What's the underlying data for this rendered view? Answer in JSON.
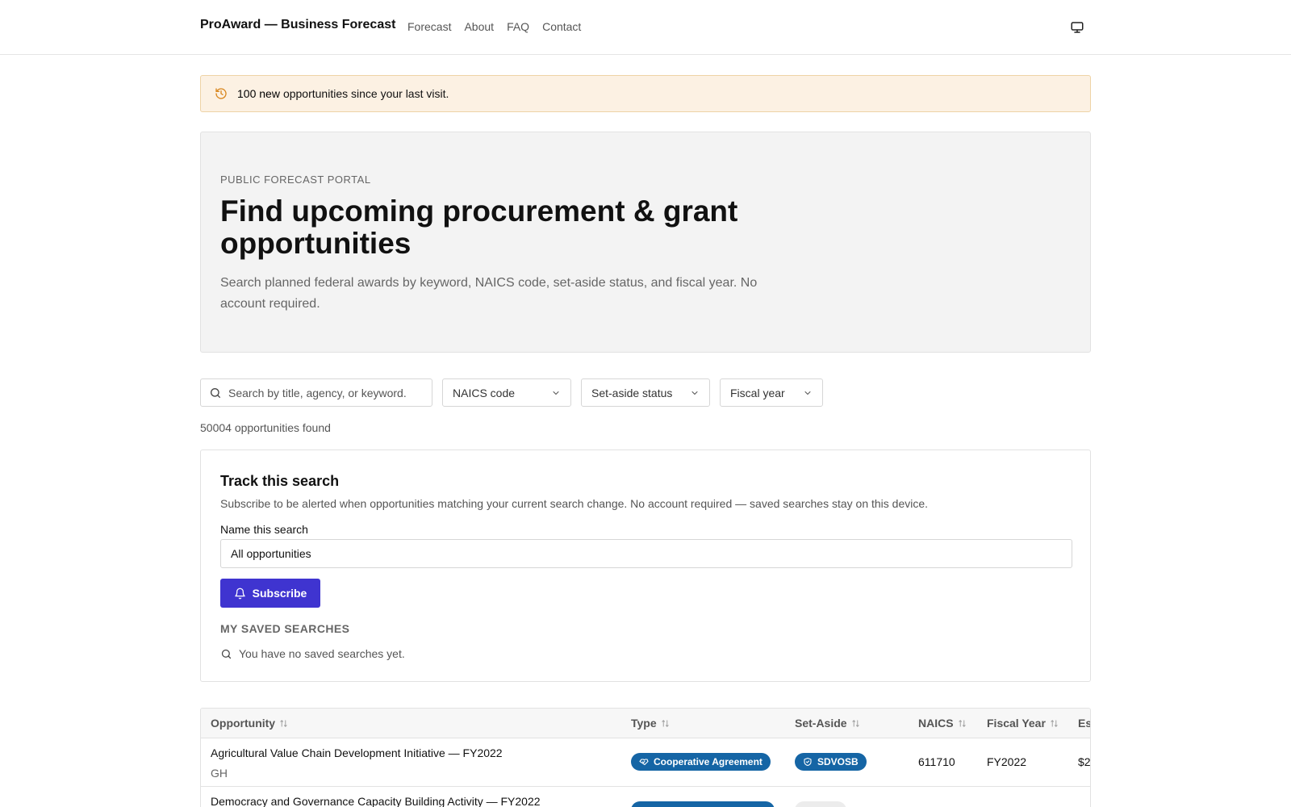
{
  "header": {
    "brand": "ProAward — Business Forecast",
    "nav": [
      "Forecast",
      "About",
      "FAQ",
      "Contact"
    ]
  },
  "notice": {
    "count_text": "100 new",
    "rest_text": "opportunities since your last visit."
  },
  "hero": {
    "eyebrow": "PUBLIC FORECAST PORTAL",
    "title": "Find upcoming procurement & grant opportunities",
    "description": "Search planned federal awards by keyword, NAICS code, set-aside status, and fiscal year. No account required."
  },
  "filters": {
    "search_placeholder": "Search by title, agency, or keyword.",
    "naics": "NAICS code",
    "setaside": "Set-aside status",
    "fiscal_year": "Fiscal year"
  },
  "results_count": "50004 opportunities found",
  "track": {
    "title": "Track this search",
    "subtitle": "Subscribe to be alerted when opportunities matching your current search change. No account required — saved searches stay on this device.",
    "name_label": "Name this search",
    "name_value": "All opportunities",
    "subscribe_label": "Subscribe",
    "saved_heading": "MY SAVED SEARCHES",
    "empty_text": "You have no saved searches yet."
  },
  "table": {
    "columns": [
      "Opportunity",
      "Type",
      "Set-Aside",
      "NAICS",
      "Fiscal Year",
      "Es"
    ],
    "rows": [
      {
        "title": "Agricultural Value Chain Development Initiative — FY2022",
        "agency": "GH",
        "type": "Cooperative Agreement",
        "setaside": "SDVOSB",
        "naics": "611710",
        "fiscal_year": "FY2022",
        "estimate": "$2"
      },
      {
        "title": "Democracy and Governance Capacity Building Activity — FY2022"
      }
    ]
  },
  "colors": {
    "accent": "#3f34d0",
    "badge": "#1565a5",
    "notice_bg": "#fcf1e3",
    "notice_icon": "#d9871f"
  }
}
